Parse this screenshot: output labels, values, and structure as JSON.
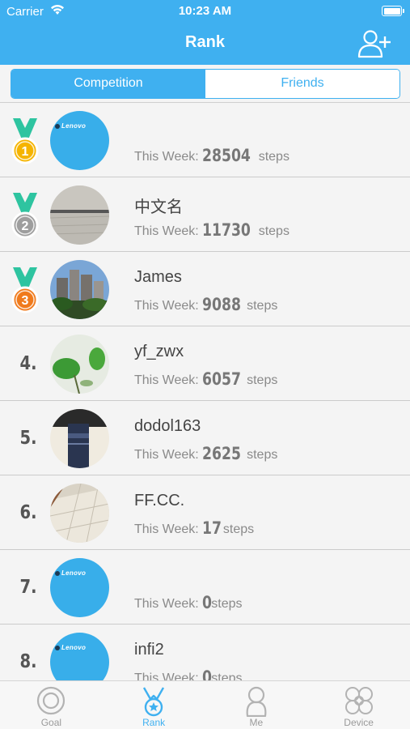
{
  "status_bar": {
    "carrier": "Carrier",
    "time": "10:23 AM"
  },
  "nav": {
    "title": "Rank",
    "add_friend_icon": "add-user-icon"
  },
  "segments": [
    {
      "label": "Competition",
      "selected": true
    },
    {
      "label": "Friends",
      "selected": false
    }
  ],
  "rankings": [
    {
      "rank": "1",
      "medal": "gold",
      "name": "",
      "avatar": "lenovo",
      "steps": "28504"
    },
    {
      "rank": "2",
      "medal": "silver",
      "name": "中文名",
      "avatar": "photo-floor",
      "steps": "11730"
    },
    {
      "rank": "3",
      "medal": "bronze",
      "name": "James",
      "avatar": "photo-buildings",
      "steps": "9088"
    },
    {
      "rank": "4.",
      "medal": "",
      "name": "yf_zwx",
      "avatar": "photo-plant",
      "steps": "6057"
    },
    {
      "rank": "5.",
      "medal": "",
      "name": "dodol163",
      "avatar": "photo-bottle",
      "steps": "2625"
    },
    {
      "rank": "6.",
      "medal": "",
      "name": "FF.CC.",
      "avatar": "photo-ceiling",
      "steps": "17"
    },
    {
      "rank": "7.",
      "medal": "",
      "name": "",
      "avatar": "lenovo",
      "steps": "0"
    },
    {
      "rank": "8.",
      "medal": "",
      "name": "infi2",
      "avatar": "lenovo",
      "steps": "0"
    }
  ],
  "labels": {
    "this_week": "This Week:",
    "steps_unit": "steps",
    "lenovo": "Lenovo"
  },
  "tabs": [
    {
      "label": "Goal",
      "icon": "goal-icon",
      "active": false
    },
    {
      "label": "Rank",
      "icon": "medal-icon",
      "active": true
    },
    {
      "label": "Me",
      "icon": "person-icon",
      "active": false
    },
    {
      "label": "Device",
      "icon": "device-icon",
      "active": false
    }
  ],
  "colors": {
    "accent": "#3fb0f0",
    "gold": "#f5b400",
    "silver": "#9e9e9e",
    "bronze": "#f07a1c",
    "ribbon": "#2ec4a0"
  }
}
